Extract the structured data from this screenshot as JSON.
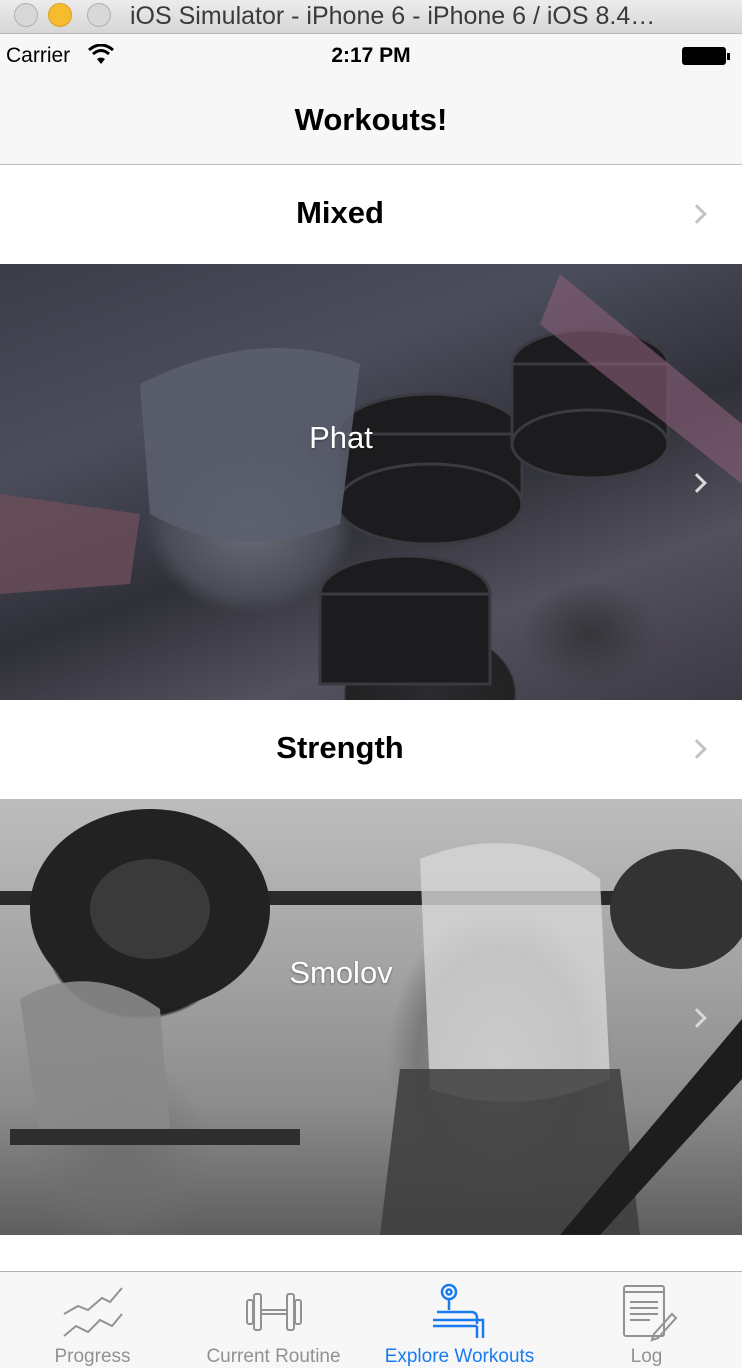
{
  "window": {
    "title": "iOS Simulator - iPhone 6 - iPhone 6 / iOS 8.4…"
  },
  "status_bar": {
    "carrier": "Carrier",
    "time": "2:17 PM",
    "wifi_icon": "wifi-icon",
    "battery_icon": "battery-icon"
  },
  "nav": {
    "title": "Workouts!"
  },
  "sections": [
    {
      "title": "Mixed",
      "rows": [
        {
          "label": "Phat",
          "image": "gym-dumbbell-photo"
        }
      ]
    },
    {
      "title": "Strength",
      "rows": [
        {
          "label": "Smolov",
          "image": "barbell-squat-photo"
        }
      ]
    }
  ],
  "tab_bar": {
    "items": [
      {
        "label": "Progress",
        "icon": "progress-chart-icon",
        "active": false
      },
      {
        "label": "Current Routine",
        "icon": "dumbbell-icon",
        "active": false
      },
      {
        "label": "Explore Workouts",
        "icon": "bench-press-icon",
        "active": true
      },
      {
        "label": "Log",
        "icon": "log-notepad-icon",
        "active": false
      }
    ]
  },
  "colors": {
    "accent": "#1a7bf0",
    "inactive_tab": "#929292",
    "chevron": "#c4c4c8",
    "bar_background": "#f7f7f7"
  }
}
